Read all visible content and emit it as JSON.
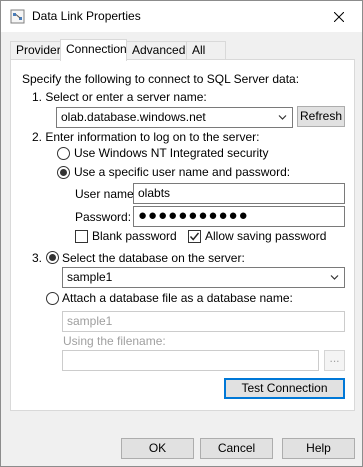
{
  "window": {
    "title": "Data Link Properties"
  },
  "tabs": [
    {
      "label": "Provider"
    },
    {
      "label": "Connection"
    },
    {
      "label": "Advanced"
    },
    {
      "label": "All"
    }
  ],
  "connection": {
    "intro": "Specify the following to connect to SQL Server data:",
    "step1_label": "1. Select or enter a server name:",
    "server_name": "olab.database.windows.net",
    "refresh_label": "Refresh",
    "step2_label": "2. Enter information to log on to the server:",
    "nt_security_label": "Use Windows NT Integrated security",
    "specific_user_label": "Use a specific user name and password:",
    "username_label": "User name:",
    "username_value": "olabts",
    "password_label": "Password:",
    "password_value": "●●●●●●●●●●●",
    "blank_password_label": "Blank password",
    "allow_saving_label": "Allow saving password",
    "step3_label": "3.",
    "select_db_label": "Select the database on the server:",
    "database_value": "sample1",
    "attach_label": "Attach a database file as a database name:",
    "attach_name_value": "sample1",
    "filename_label": "Using the filename:",
    "filename_value": "",
    "browse_label": "...",
    "test_label": "Test Connection"
  },
  "footer": {
    "ok_label": "OK",
    "cancel_label": "Cancel",
    "help_label": "Help"
  },
  "state": {
    "active_tab": "Connection",
    "logon_mode": "specific_user",
    "blank_password": false,
    "allow_saving_password": true,
    "db_mode": "select"
  },
  "colors": {
    "accent": "#0078d7",
    "window_bg": "#f0f0f0",
    "panel_bg": "#ffffff"
  }
}
